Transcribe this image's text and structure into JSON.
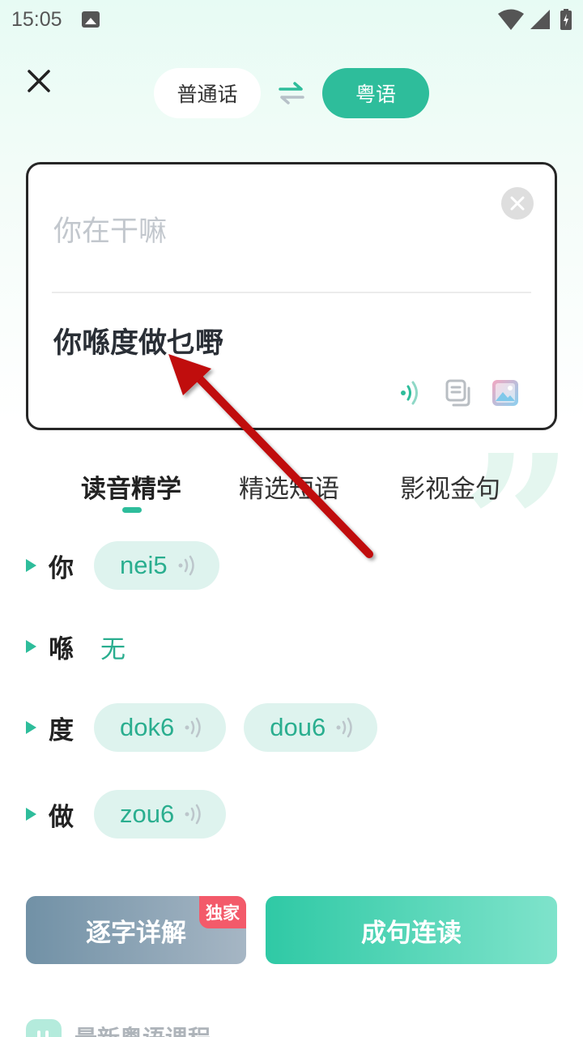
{
  "status": {
    "time": "15:05"
  },
  "languages": {
    "source": "普通话",
    "target": "粤语"
  },
  "translator": {
    "source_text": "你在干嘛",
    "result_text": "你喺度做乜嘢"
  },
  "tabs": [
    {
      "label": "读音精学",
      "active": true
    },
    {
      "label": "精选短语",
      "active": false
    },
    {
      "label": "影视金句",
      "active": false
    }
  ],
  "chars": [
    {
      "char": "你",
      "prons": [
        "nei5"
      ],
      "empty": ""
    },
    {
      "char": "喺",
      "prons": [],
      "empty": "无"
    },
    {
      "char": "度",
      "prons": [
        "dok6",
        "dou6"
      ],
      "empty": ""
    },
    {
      "char": "做",
      "prons": [
        "zou6"
      ],
      "empty": ""
    }
  ],
  "buttons": {
    "detail": "逐字详解",
    "badge": "独家",
    "read": "成句连读"
  },
  "course": {
    "title": "最新粤语课程"
  },
  "colors": {
    "accent": "#2ebd9b",
    "chip_bg": "#def3ee",
    "arrow": "#c0070b",
    "badge": "#f35a6a"
  },
  "icons": {
    "close": "close-icon",
    "swap": "swap-arrows-icon",
    "clear": "clear-circle-icon",
    "sound": "sound-wave-icon",
    "copy": "copy-icon",
    "image": "image-icon"
  }
}
